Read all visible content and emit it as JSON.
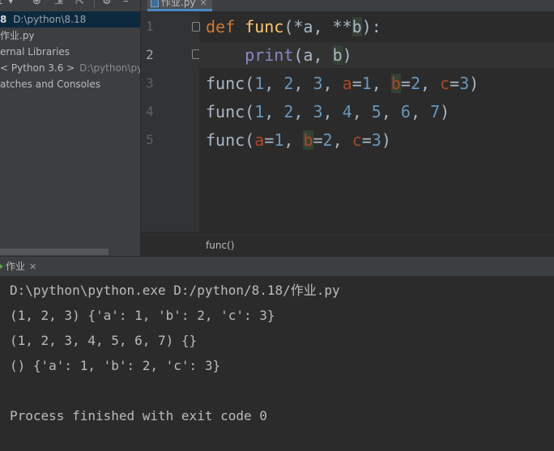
{
  "project_panel": {
    "tree": [
      {
        "prefix": "8",
        "label": "D:\\python\\8.18"
      },
      {
        "label": "作业.py"
      },
      {
        "label": "ernal Libraries"
      },
      {
        "prefix": "<",
        "label": "Python 3.6 >",
        "hint": "D:\\python\\pyth"
      },
      {
        "label": "atches and Consoles"
      }
    ]
  },
  "editor": {
    "tab": {
      "label": "作业.py"
    },
    "line_numbers": [
      "1",
      "2",
      "3",
      "4",
      "5"
    ],
    "current_line": 2,
    "breadcrumb": "func()"
  },
  "run_panel": {
    "tab_label": "作业",
    "output": [
      "D:\\python\\python.exe D:/python/8.18/作业.py",
      "(1, 2, 3) {'a': 1, 'b': 2, 'c': 3}",
      "(1, 2, 3, 4, 5, 6, 7) {}",
      "() {'a': 1, 'b': 2, 'c': 3}",
      "",
      "Process finished with exit code 0"
    ]
  },
  "colors": {
    "keyword": "#cc7832",
    "function": "#ffc66d",
    "builtin": "#8888c6",
    "number": "#6897bb",
    "parameter": "#aa4926",
    "selection": "#0d293e"
  }
}
